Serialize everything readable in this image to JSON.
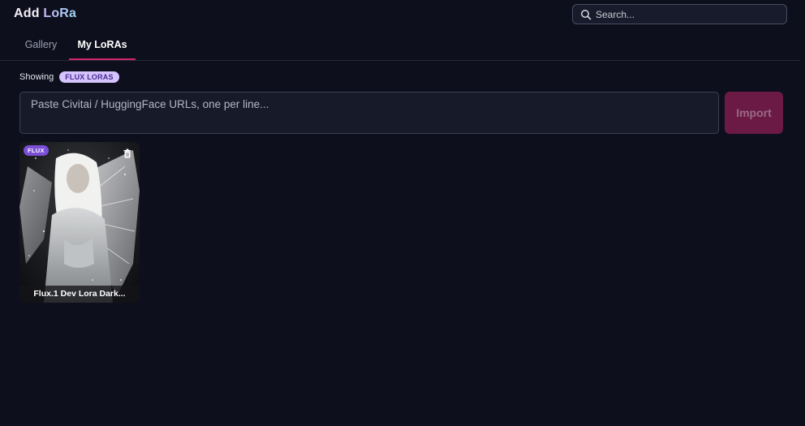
{
  "header": {
    "title_part1": "Add ",
    "title_part2": "LoRa",
    "search_placeholder": "Search...",
    "search_icon": "search-icon"
  },
  "tabs": [
    {
      "label": "Gallery",
      "active": false
    },
    {
      "label": "My LoRAs",
      "active": true
    }
  ],
  "filter": {
    "label": "Showing",
    "badge": "FLUX LORAS"
  },
  "import": {
    "placeholder": "Paste Civitai / HuggingFace URLs, one per line...",
    "button_label": "Import"
  },
  "loras": [
    {
      "tag": "FLUX",
      "name": "Flux.1 Dev Lora Dark...",
      "delete_icon": "trash-icon"
    }
  ],
  "colors": {
    "background": "#0d0f1c",
    "accent": "#d1266e",
    "badge_bg": "#d6c4ff",
    "tag_bg": "#7b4fd6"
  }
}
